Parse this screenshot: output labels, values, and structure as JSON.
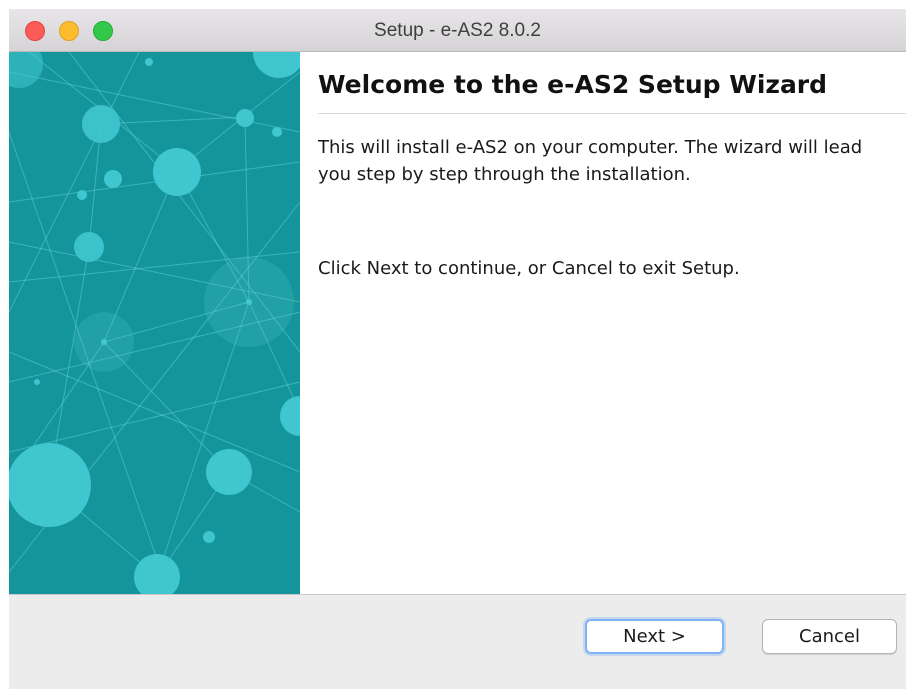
{
  "window": {
    "title": "Setup - e-AS2 8.0.2",
    "traffic_lights": {
      "close": "#fc5b57",
      "minimize": "#fdbc2e",
      "zoom": "#34c84a"
    }
  },
  "wizard": {
    "heading": "Welcome to the e-AS2 Setup Wizard",
    "intro_text": "This will install e-AS2 on your computer. The wizard will lead you step by step through the installation.",
    "instruction_text": "Click Next to continue, or Cancel to exit Setup.",
    "side_image": {
      "background_color": "#14959c",
      "node_color": "#3fc6cf"
    }
  },
  "buttons": {
    "next_label": "Next >",
    "cancel_label": "Cancel"
  }
}
